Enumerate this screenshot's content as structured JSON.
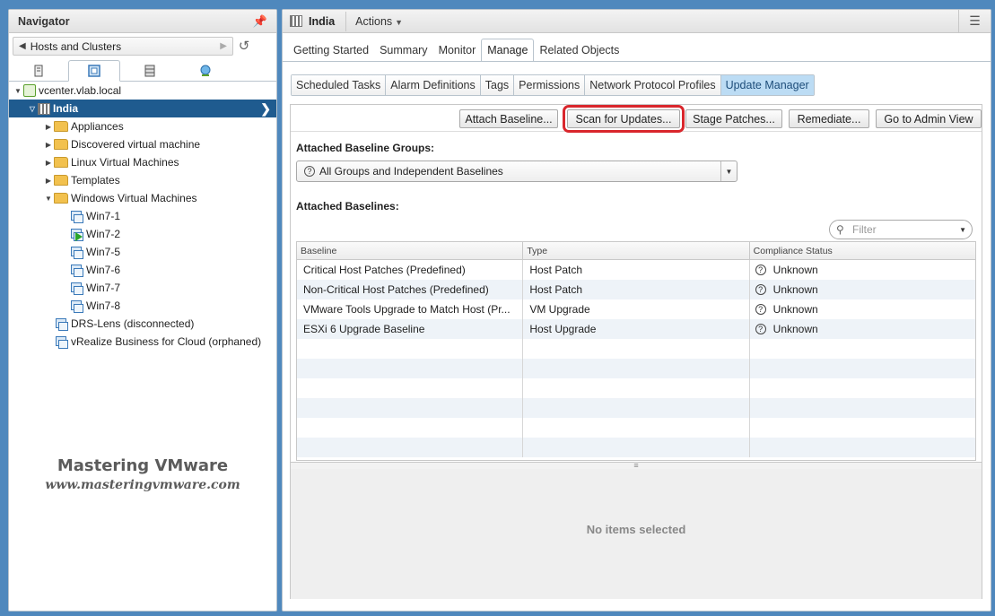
{
  "navigator": {
    "title": "Navigator",
    "breadcrumb": "Hosts and Clusters",
    "tabs": [
      "hosts-clusters",
      "vms-templates",
      "storage",
      "networking"
    ],
    "tree": {
      "vcenter": "vcenter.vlab.local",
      "datacenter": "India",
      "folders": [
        "Appliances",
        "Discovered virtual machine",
        "Linux Virtual Machines",
        "Templates",
        "Windows Virtual Machines"
      ],
      "vms": [
        "Win7-1",
        "Win7-2",
        "Win7-5",
        "Win7-6",
        "Win7-7",
        "Win7-8"
      ],
      "other": [
        "DRS-Lens (disconnected)",
        "vRealize Business for Cloud (orphaned)"
      ]
    },
    "watermark": {
      "line1": "Mastering VMware",
      "line2": "www.masteringvmware.com"
    }
  },
  "main": {
    "object_title": "India",
    "actions_label": "Actions",
    "tabs": [
      "Getting Started",
      "Summary",
      "Monitor",
      "Manage",
      "Related Objects"
    ],
    "active_tab": "Manage",
    "subtabs": [
      "Scheduled Tasks",
      "Alarm Definitions",
      "Tags",
      "Permissions",
      "Network Protocol Profiles",
      "Update Manager"
    ],
    "active_subtab": "Update Manager",
    "buttons": {
      "attach_baseline": "Attach Baseline...",
      "scan_for_updates": "Scan for Updates...",
      "stage_patches": "Stage Patches...",
      "remediate": "Remediate...",
      "admin_view": "Go to Admin View"
    },
    "attached_groups_label": "Attached Baseline Groups:",
    "groups_dropdown_value": "All Groups and Independent Baselines",
    "attached_baselines_label": "Attached Baselines:",
    "filter_placeholder": "Filter",
    "grid": {
      "headers": [
        "Baseline",
        "Type",
        "Compliance Status"
      ],
      "rows": [
        {
          "baseline": "Critical Host Patches (Predefined)",
          "type": "Host Patch",
          "status": "Unknown"
        },
        {
          "baseline": "Non-Critical Host Patches (Predefined)",
          "type": "Host Patch",
          "status": "Unknown"
        },
        {
          "baseline": "VMware Tools Upgrade to Match Host (Pr...",
          "type": "VM Upgrade",
          "status": "Unknown"
        },
        {
          "baseline": "ESXi 6 Upgrade Baseline",
          "type": "Host Upgrade",
          "status": "Unknown"
        }
      ]
    },
    "no_items_text": "No items selected"
  },
  "colors": {
    "background": "#4f88bd",
    "selected_row": "#1f5b8f",
    "active_subtab": "#bcdcf4",
    "highlight_frame": "#d9262c"
  }
}
